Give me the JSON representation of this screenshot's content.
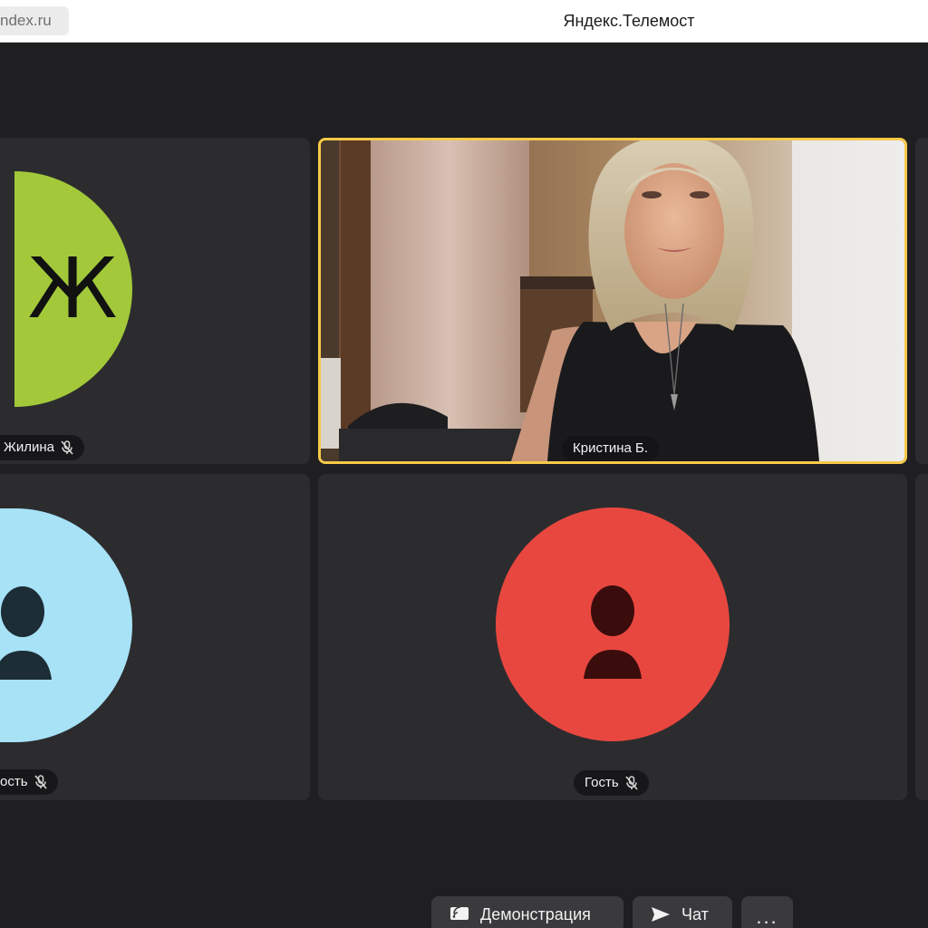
{
  "browser": {
    "url_fragment": "ndex.ru",
    "window_title": "Яндекс.Телемост"
  },
  "participants": [
    {
      "label": "Жилина",
      "initial": "Ж",
      "avatar_color": "#a3c93a",
      "muted": true,
      "speaking": false,
      "kind": "initial"
    },
    {
      "label": "Кристина Б.",
      "muted": false,
      "speaking": true,
      "kind": "video"
    },
    {
      "label": "ость",
      "avatar_color": "#a7e2f7",
      "figure_color": "#1d2d35",
      "muted": true,
      "speaking": false,
      "kind": "placeholder"
    },
    {
      "label": "Гость",
      "avatar_color": "#e8473f",
      "figure_color": "#3a0d0c",
      "muted": true,
      "speaking": false,
      "kind": "placeholder"
    }
  ],
  "controls": {
    "screen_share_label": "Демонстрация",
    "chat_label": "Чат",
    "more_label": "..."
  },
  "colors": {
    "background": "#1f1f21",
    "tile": "#2c2c2f",
    "speaking_border": "#f7c948"
  }
}
